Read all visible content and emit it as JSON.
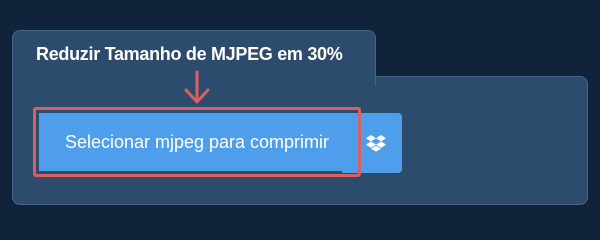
{
  "card": {
    "title": "Reduzir Tamanho de MJPEG em 30%"
  },
  "upload": {
    "select_label": "Selecionar mjpeg para comprimir",
    "dropbox_icon": "dropbox-icon"
  },
  "colors": {
    "page_background": "#11233a",
    "panel_background": "#2d4b6c",
    "button_blue": "#4f9eec",
    "highlight_red": "#d9605f"
  }
}
